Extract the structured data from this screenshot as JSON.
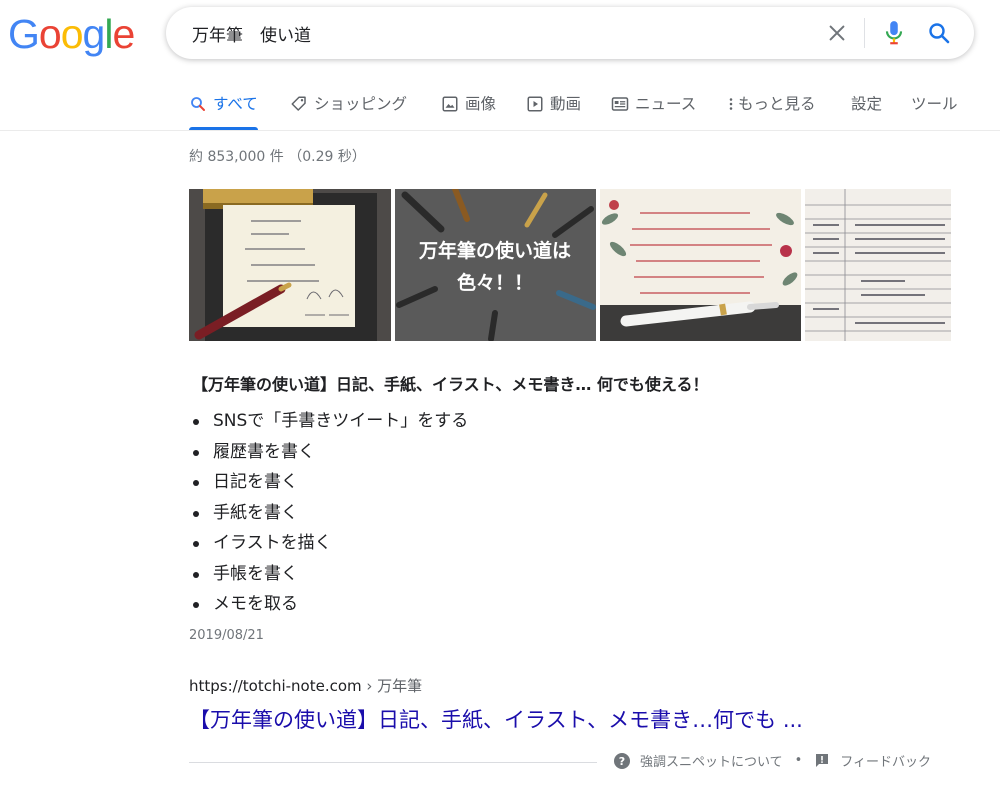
{
  "logo": {
    "letters": [
      {
        "ch": "G",
        "color": "#4285F4"
      },
      {
        "ch": "o",
        "color": "#EA4335"
      },
      {
        "ch": "o",
        "color": "#FBBC05"
      },
      {
        "ch": "g",
        "color": "#4285F4"
      },
      {
        "ch": "l",
        "color": "#34A853"
      },
      {
        "ch": "e",
        "color": "#EA4335"
      }
    ]
  },
  "search": {
    "value": "万年筆　使い道",
    "clear_icon": "close-icon",
    "mic_icon": "microphone-icon",
    "search_icon": "search-icon"
  },
  "tabs": [
    {
      "label": "すべて",
      "icon": "search-icon",
      "active": true
    },
    {
      "label": "ショッピング",
      "icon": "tag-icon",
      "active": false
    },
    {
      "label": "画像",
      "icon": "image-icon",
      "active": false
    },
    {
      "label": "動画",
      "icon": "video-icon",
      "active": false
    },
    {
      "label": "ニュース",
      "icon": "news-icon",
      "active": false
    },
    {
      "label": "もっと見る",
      "icon": "more-vert-icon",
      "active": false
    },
    {
      "label": "設定",
      "icon": "",
      "active": false
    },
    {
      "label": "ツール",
      "icon": "",
      "active": false
    }
  ],
  "result_stats": "約 853,000 件 （0.29 秒）",
  "image_thumbs": {
    "thumb2_text_line1": "万年筆の使い道は",
    "thumb2_text_line2": "色々！！"
  },
  "snippet": {
    "title": "【万年筆の使い道】日記、手紙、イラスト、メモ書き… 何でも使える！",
    "items": [
      "SNSで「手書きツイート」をする",
      "履歴書を書く",
      "日記を書く",
      "手紙を書く",
      "イラストを描く",
      "手帳を書く",
      "メモを取る"
    ],
    "date": "2019/08/21"
  },
  "result": {
    "cite_url": "https://totchi-note.com",
    "cite_crumb": " › 万年筆",
    "title": "【万年筆の使い道】日記、手紙、イラスト、メモ書き…何でも ..."
  },
  "footer": {
    "about_label": "強調スニペットについて",
    "feedback_label": "フィードバック",
    "separator": "•"
  },
  "colors": {
    "accent": "#1a73e8",
    "link": "#1a0dab",
    "meta_text": "#70757a"
  }
}
